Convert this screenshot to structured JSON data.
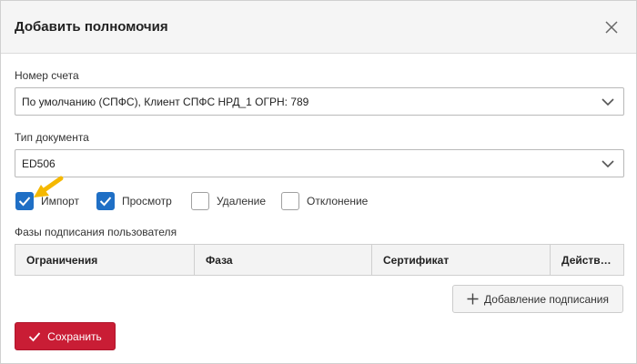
{
  "dialog": {
    "title": "Добавить полномочия",
    "close_icon": "close-icon"
  },
  "account": {
    "label": "Номер счета",
    "value": "По умолчанию (СПФС), Клиент СПФС НРД_1 ОГРН: 789"
  },
  "doc_type": {
    "label": "Тип документа",
    "value": "ED506"
  },
  "permissions": [
    {
      "label": "Импорт",
      "checked": true
    },
    {
      "label": "Просмотр",
      "checked": true
    },
    {
      "label": "Удаление",
      "checked": false
    },
    {
      "label": "Отклонение",
      "checked": false
    }
  ],
  "signing": {
    "section_label": "Фазы подписания пользователя",
    "columns": [
      "Ограничения",
      "Фаза",
      "Сертификат",
      "Действ…"
    ],
    "add_button": "Добавление подписания"
  },
  "save_button": "Сохранить",
  "colors": {
    "accent": "#1f6fc5",
    "primary_button": "#c91d35",
    "pointer": "#f5b800"
  }
}
